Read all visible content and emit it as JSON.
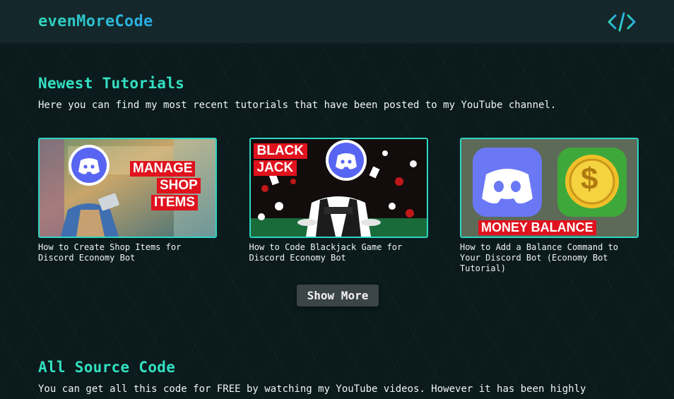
{
  "header": {
    "brand": "evenMoreCode",
    "icon": "code-brackets-icon"
  },
  "tutorials": {
    "heading": "Newest Tutorials",
    "description": "Here you can find my most recent tutorials that have been posted to my YouTube channel.",
    "items": [
      {
        "title": "How to Create Shop Items for Discord Economy Bot",
        "thumb_text": [
          "MANAGE",
          "SHOP",
          "ITEMS"
        ]
      },
      {
        "title": "How to Code Blackjack Game for Discord Economy Bot",
        "thumb_text": [
          "BLACK",
          "JACK"
        ]
      },
      {
        "title": "How to Add a Balance Command to Your Discord Bot (Economy Bot Tutorial)",
        "thumb_text": [
          "MONEY BALANCE"
        ]
      }
    ],
    "show_more": "Show More"
  },
  "source": {
    "heading": "All Source Code",
    "description": "You can get all this code for FREE by watching my YouTube videos. However it has been highly"
  },
  "colors": {
    "accent": "#33e0c2",
    "header_bg": "#15272a",
    "page_bg": "#0b1a1c",
    "label_red": "#e0121e"
  }
}
